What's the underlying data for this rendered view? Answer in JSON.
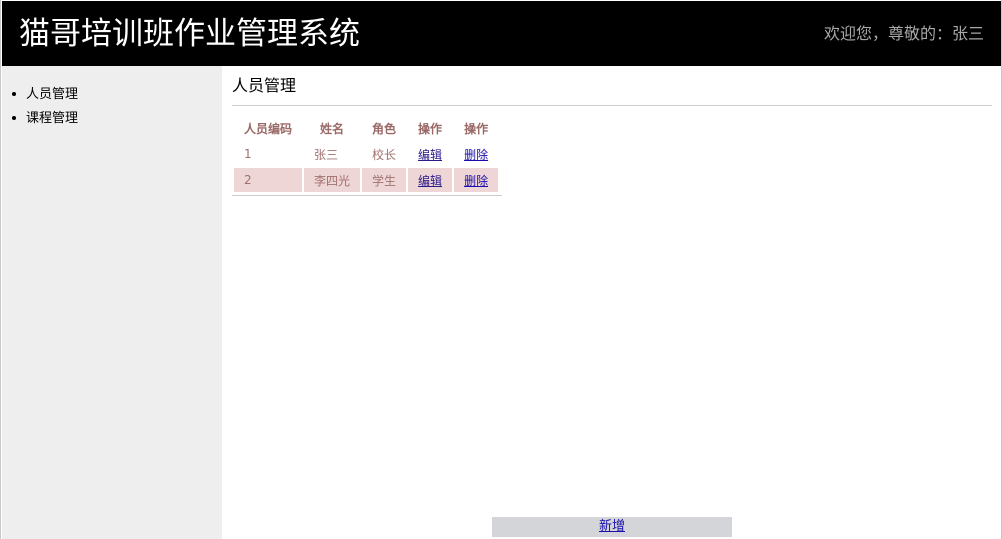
{
  "header": {
    "app_title": "猫哥培训班作业管理系统",
    "welcome_text": "欢迎您，尊敬的：张三"
  },
  "sidebar": {
    "items": [
      {
        "label": "人员管理"
      },
      {
        "label": "课程管理"
      }
    ]
  },
  "main": {
    "page_title": "人员管理",
    "table": {
      "headers": [
        "人员编码",
        "姓名",
        "角色",
        "操作",
        "操作"
      ],
      "rows": [
        {
          "id": "1",
          "name": "张三",
          "role": "校长",
          "edit": "编辑",
          "delete": "删除"
        },
        {
          "id": "2",
          "name": "李四光",
          "role": "学生",
          "edit": "编辑",
          "delete": "删除"
        }
      ]
    },
    "add_label": "新增"
  },
  "colors": {
    "header_bg": "#000000",
    "sidebar_bg": "#eeeeee",
    "row_alt_bg": "#efd6d6",
    "table_text": "#a0706e",
    "footer_bar_bg": "#d4d5d8"
  }
}
